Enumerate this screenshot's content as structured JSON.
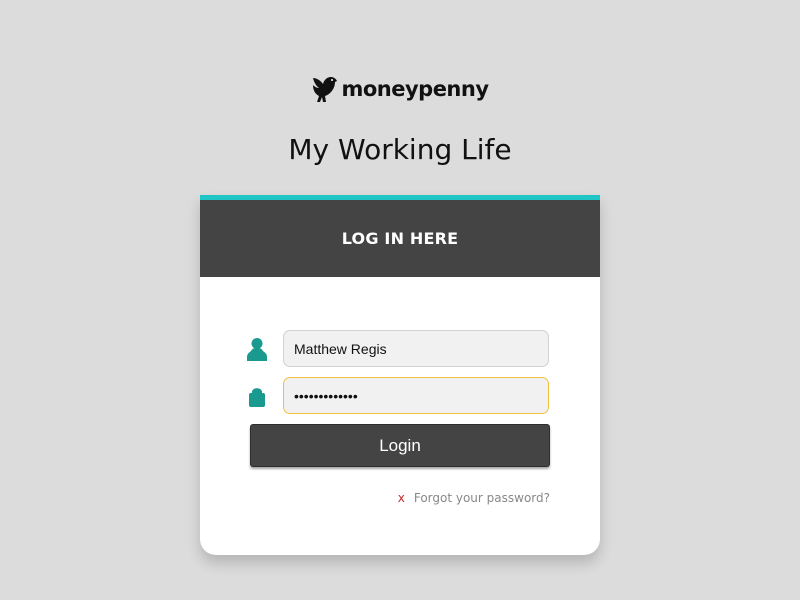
{
  "brand": {
    "logo_text": "moneypenny"
  },
  "app_title": "My Working Life",
  "login_card": {
    "header_title": "LOG IN HERE",
    "accent_color": "#1fc4c4",
    "username": {
      "icon": "user-icon",
      "value": "Matthew Regis"
    },
    "password": {
      "icon": "lock-icon",
      "value": "•••••••••••••"
    },
    "login_button_label": "Login",
    "forgot_password": {
      "icon": "x-icon",
      "label": "Forgot your password?"
    }
  },
  "colors": {
    "background": "#dcdcdc",
    "header": "#444444",
    "icon": "#1a9a8e",
    "forgot_x": "#cc2b2b"
  }
}
